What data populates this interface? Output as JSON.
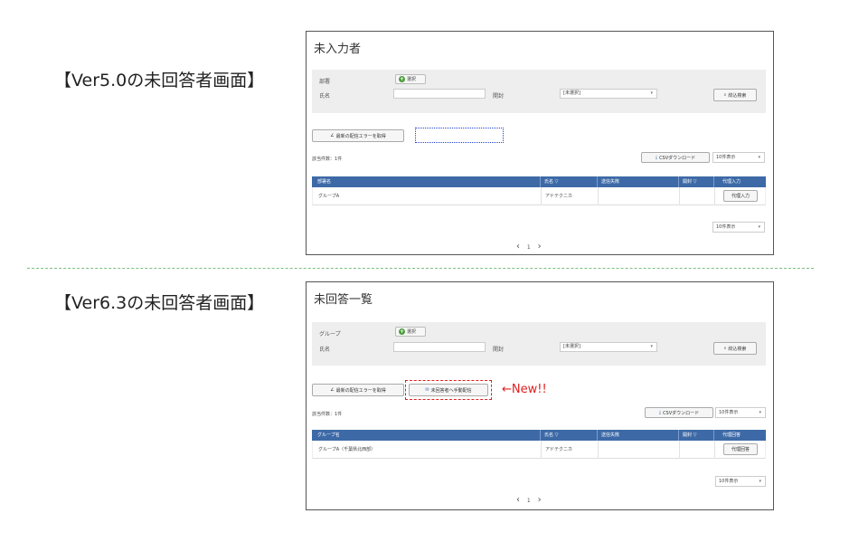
{
  "captions": {
    "v50": "【Ver5.0の未回答者画面】",
    "v63": "【Ver6.3の未回答者画面】"
  },
  "v50": {
    "title": "未入力者",
    "filter": {
      "field1_label": "部署",
      "select_button": "選択",
      "name_label": "氏名",
      "opened_label": "開封",
      "opened_value": "[未選択]",
      "search_button": "絞込検索"
    },
    "error_button": "最新の配信エラーを取得",
    "result_count": "該当件数：1件",
    "csv_button": "CSVダウンロード",
    "per_page": "10件表示",
    "columns": [
      "部署名",
      "氏名 ▽",
      "送信失敗",
      "開封 ▽",
      "代理入力"
    ],
    "rows": [
      {
        "group": "グループA",
        "name": "アドテクニカ",
        "fail": "",
        "opened": "",
        "action": "代理入力"
      }
    ],
    "per_page_bottom": "10件表示",
    "pager": {
      "prev": "‹",
      "page": "1",
      "next": "›"
    }
  },
  "v63": {
    "title": "未回答一覧",
    "filter": {
      "field1_label": "グループ",
      "select_button": "選択",
      "name_label": "氏名",
      "opened_label": "開封",
      "opened_value": "[未選択]",
      "search_button": "絞込検索"
    },
    "error_button": "最新の配信エラーを取得",
    "manual_send_button": "未回答者へ手動配信",
    "new_label": "←New!!",
    "result_count": "該当件数：1件",
    "csv_button": "CSVダウンロード",
    "per_page": "10件表示",
    "columns": [
      "グループ名",
      "氏名 ▽",
      "送信失敗",
      "開封 ▽",
      "代理回答"
    ],
    "rows": [
      {
        "group": "グループA（千葉県北西部）",
        "name": "アドテクニカ",
        "fail": "",
        "opened": "",
        "action": "代理回答"
      }
    ],
    "per_page_bottom": "10件表示",
    "pager": {
      "prev": "‹",
      "page": "1",
      "next": "›"
    }
  },
  "colors": {
    "header": "#3d6aa7",
    "accent_red": "#e02020",
    "divider": "#7bbf7b"
  }
}
